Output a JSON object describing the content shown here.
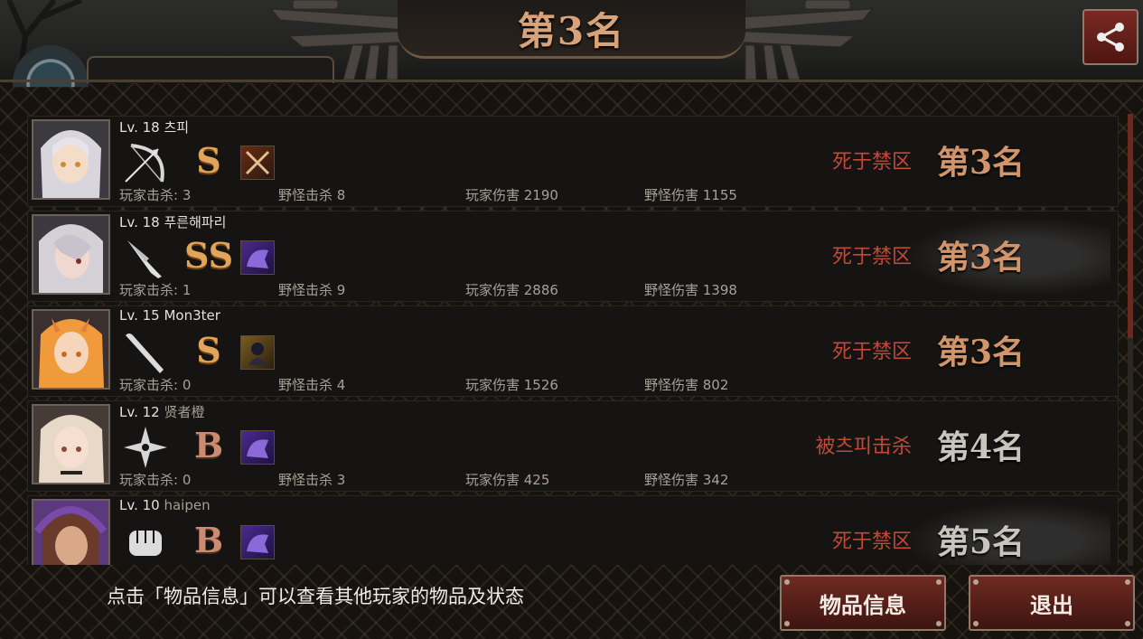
{
  "header": {
    "title": "第3名",
    "player_name_partial": "..."
  },
  "players": [
    {
      "level": "Lv. 18",
      "name": "츠피",
      "weapon_icon": "bow-icon",
      "grade": "S",
      "item_icon": "crossed-blades-item-icon",
      "player_kills": "玩家击杀: 3",
      "monster_kills": "野怪击杀 8",
      "player_damage": "玩家伤害 2190",
      "monster_damage": "野怪伤害 1155",
      "death_reason": "死于禁区",
      "rank": "第3名",
      "hair_color": "#d8d6dc"
    },
    {
      "level": "Lv. 18",
      "name": "푸른해파리",
      "weapon_icon": "knife-icon",
      "grade": "SS",
      "item_icon": "purple-creature-item-icon",
      "player_kills": "玩家击杀: 1",
      "monster_kills": "野怪击杀 9",
      "player_damage": "玩家伤害 2886",
      "monster_damage": "野怪伤害 1398",
      "death_reason": "死于禁区",
      "rank": "第3名",
      "hair_color": "#d5d0d6"
    },
    {
      "level": "Lv. 15",
      "name": "Mon3ter",
      "weapon_icon": "bat-icon",
      "grade": "S",
      "item_icon": "ninja-item-icon",
      "player_kills": "玩家击杀: 0",
      "monster_kills": "野怪击杀 4",
      "player_damage": "玩家伤害 1526",
      "monster_damage": "野怪伤害 802",
      "death_reason": "死于禁区",
      "rank": "第3名",
      "hair_color": "#f09a3c"
    },
    {
      "level": "Lv. 12",
      "name": "贤者橙",
      "weapon_icon": "shuriken-icon",
      "grade": "B",
      "item_icon": "purple-creature-item-icon",
      "player_kills": "玩家击杀: 0",
      "monster_kills": "野怪击杀 3",
      "player_damage": "玩家伤害 425",
      "monster_damage": "野怪伤害 342",
      "death_reason": "被츠피击杀",
      "rank": "第4名",
      "hair_color": "#e8d8c8"
    },
    {
      "level": "Lv. 10",
      "name": "haipen",
      "weapon_icon": "fist-icon",
      "grade": "B",
      "item_icon": "purple-creature-item-icon",
      "player_kills": "",
      "monster_kills": "",
      "player_damage": "",
      "monster_damage": "",
      "death_reason": "死于禁区",
      "rank": "第5名",
      "hair_color": "#6a3a2a"
    }
  ],
  "footer": {
    "hint": "点击「物品信息」可以查看其他玩家的物品及状态",
    "item_info_button": "物品信息",
    "exit_button": "退出"
  }
}
